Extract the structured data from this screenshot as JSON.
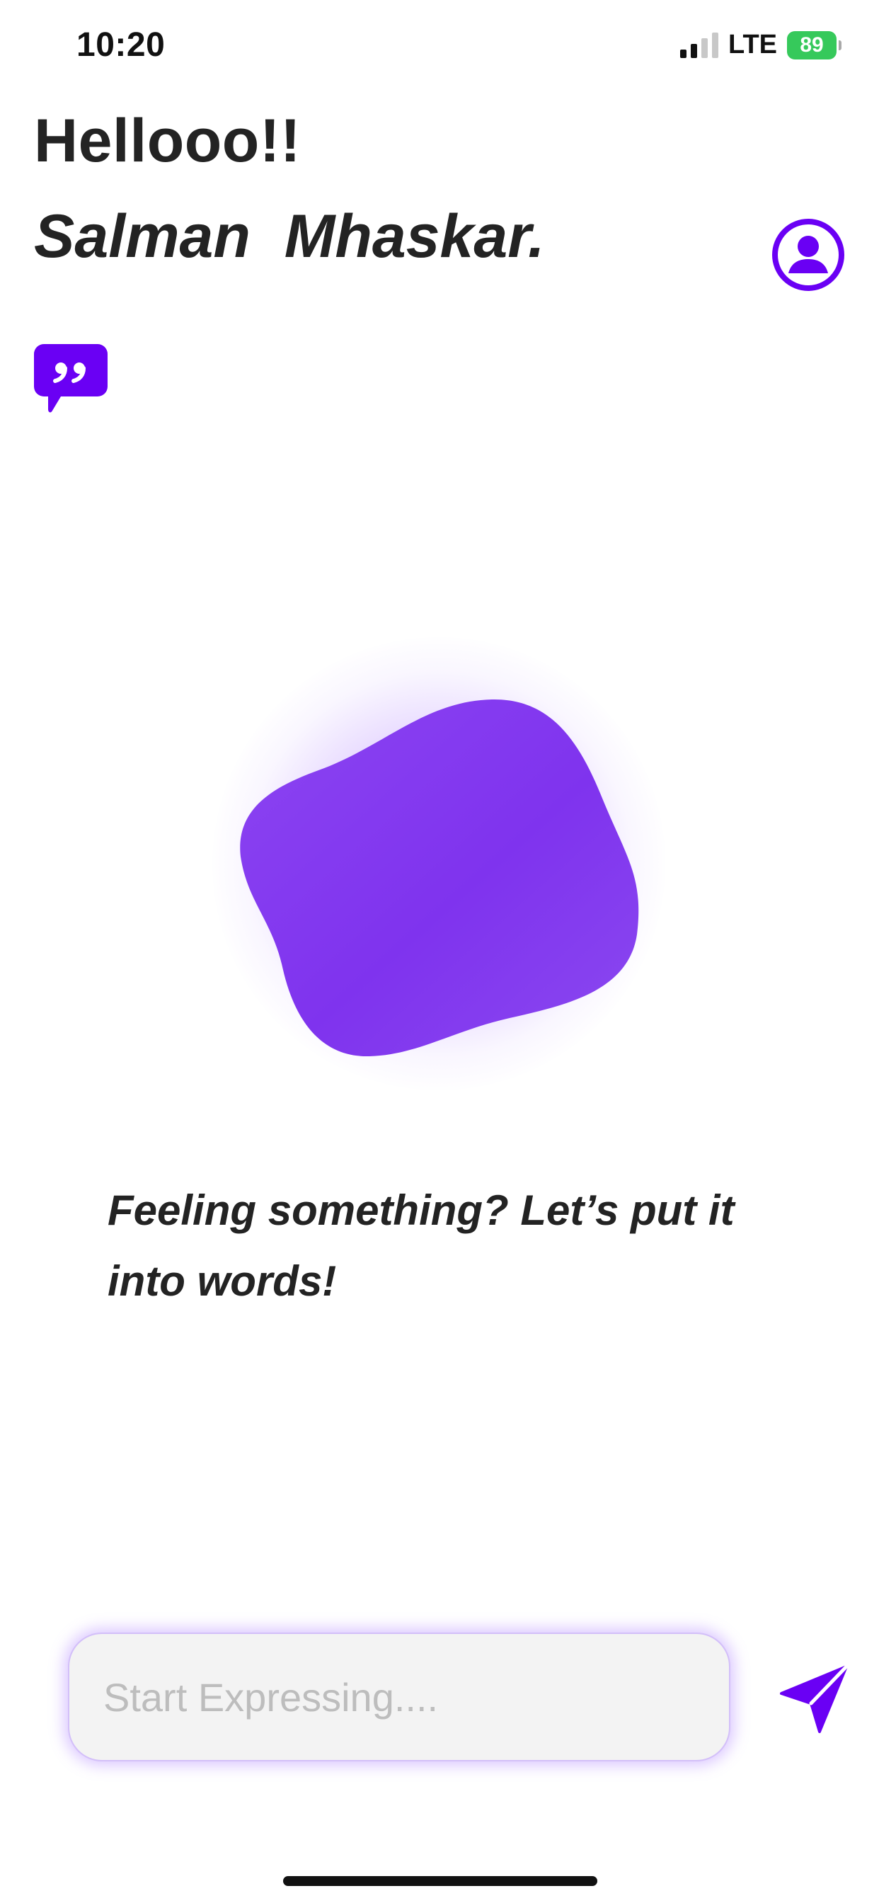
{
  "status_bar": {
    "time": "10:20",
    "network": "LTE",
    "battery_level": "89",
    "signal_bars_active": 2,
    "signal_bars_total": 4
  },
  "greeting": {
    "line1": "Hellooo!!",
    "line2": "Salman  Mhaskar."
  },
  "icons": {
    "profile": "user-circle-icon",
    "quote": "quote-bubble-icon",
    "send": "send-icon"
  },
  "prompt": {
    "text": "Feeling something? Let’s put it into words!"
  },
  "input": {
    "placeholder": "Start Expressing....",
    "value": ""
  },
  "colors": {
    "accent": "#6A00F4",
    "blob": "#8135EF",
    "battery": "#36C95B",
    "text": "#232323"
  }
}
